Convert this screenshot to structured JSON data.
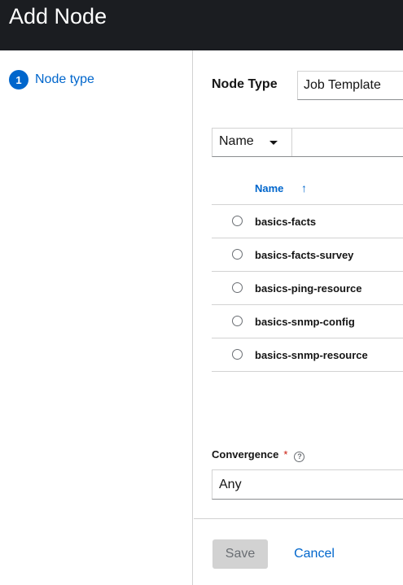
{
  "header": {
    "title": "Add Node"
  },
  "wizard": {
    "steps": [
      {
        "number": "1",
        "label": "Node type"
      }
    ]
  },
  "form": {
    "node_type_label": "Node Type",
    "node_type_value": "Job Template",
    "filter": {
      "field": "Name",
      "value": ""
    },
    "table": {
      "column_header": "Name",
      "sort_icon": "↑",
      "rows": [
        {
          "name": "basics-facts"
        },
        {
          "name": "basics-facts-survey"
        },
        {
          "name": "basics-ping-resource"
        },
        {
          "name": "basics-snmp-config"
        },
        {
          "name": "basics-snmp-resource"
        }
      ]
    },
    "convergence": {
      "label": "Convergence",
      "required_mark": "*",
      "help_icon": "?",
      "value": "Any"
    }
  },
  "footer": {
    "save_label": "Save",
    "cancel_label": "Cancel"
  },
  "colors": {
    "accent": "#0066cc",
    "header_bg": "#1b1d21",
    "required": "#c9190b"
  }
}
